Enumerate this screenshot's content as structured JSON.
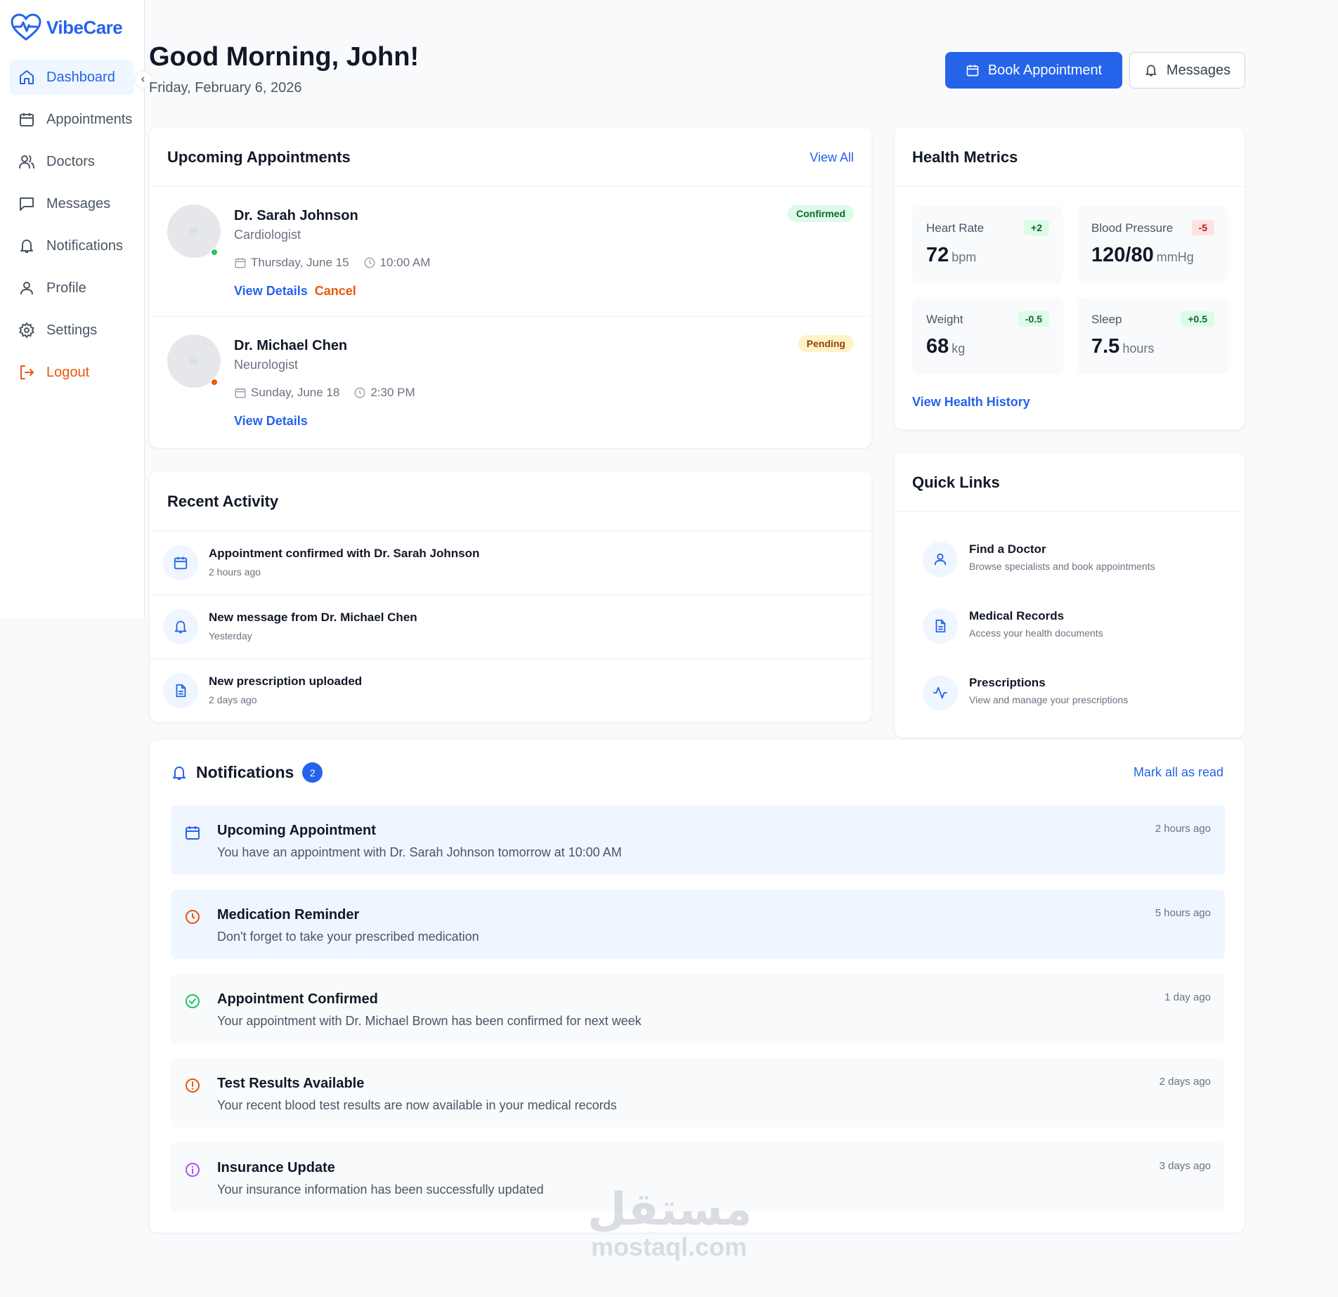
{
  "brand": {
    "name": "VibeCare",
    "color": "#2563eb"
  },
  "sidebar": {
    "items": [
      {
        "label": "Dashboard",
        "icon": "home-icon",
        "active": true
      },
      {
        "label": "Appointments",
        "icon": "calendar-icon"
      },
      {
        "label": "Doctors",
        "icon": "users-icon"
      },
      {
        "label": "Messages",
        "icon": "message-icon"
      },
      {
        "label": "Notifications",
        "icon": "bell-icon"
      },
      {
        "label": "Profile",
        "icon": "user-icon"
      },
      {
        "label": "Settings",
        "icon": "gear-icon"
      },
      {
        "label": "Logout",
        "icon": "logout-icon"
      }
    ]
  },
  "header": {
    "greeting": "Good Morning, John!",
    "date": "Friday, February 6, 2026",
    "book_label": "Book Appointment",
    "messages_label": "Messages"
  },
  "appointments": {
    "title": "Upcoming Appointments",
    "view_all": "View All",
    "items": [
      {
        "doctor": "Dr. Sarah Johnson",
        "specialty": "Cardiologist",
        "date": "Thursday, June 15",
        "time": "10:00 AM",
        "status": "Confirmed",
        "status_color": "#22c55e",
        "view": "View Details",
        "cancel": "Cancel"
      },
      {
        "doctor": "Dr. Michael Chen",
        "specialty": "Neurologist",
        "date": "Sunday, June 18",
        "time": "2:30 PM",
        "status": "Pending",
        "status_color": "#ea580c",
        "view": "View Details"
      }
    ]
  },
  "activity": {
    "title": "Recent Activity",
    "items": [
      {
        "title": "Appointment confirmed with Dr. Sarah Johnson",
        "time": "2 hours ago",
        "icon": "calendar-icon"
      },
      {
        "title": "New message from Dr. Michael Chen",
        "time": "Yesterday",
        "icon": "bell-icon"
      },
      {
        "title": "New prescription uploaded",
        "time": "2 days ago",
        "icon": "document-icon"
      }
    ]
  },
  "health": {
    "title": "Health Metrics",
    "metrics": [
      {
        "label": "Heart Rate",
        "value": "72",
        "unit": "bpm",
        "change": "+2"
      },
      {
        "label": "Blood Pressure",
        "value": "120/80",
        "unit": "mmHg",
        "change": "-5"
      },
      {
        "label": "Weight",
        "value": "68",
        "unit": "kg",
        "change": "-0.5"
      },
      {
        "label": "Sleep",
        "value": "7.5",
        "unit": "hours",
        "change": "+0.5"
      }
    ],
    "history_link": "View Health History"
  },
  "quick_links": {
    "title": "Quick Links",
    "items": [
      {
        "title": "Find a Doctor",
        "desc": "Browse specialists and book appointments",
        "icon": "user-icon"
      },
      {
        "title": "Medical Records",
        "desc": "Access your health documents",
        "icon": "document-icon"
      },
      {
        "title": "Prescriptions",
        "desc": "View and manage your prescriptions",
        "icon": "activity-icon"
      }
    ]
  },
  "notifications": {
    "title": "Notifications",
    "count": "2",
    "mark_all": "Mark all as read",
    "items": [
      {
        "title": "Upcoming Appointment",
        "message": "You have an appointment with Dr. Sarah Johnson tomorrow at 10:00 AM",
        "time": "2 hours ago",
        "icon": "calendar-icon",
        "color": "#2563eb",
        "unread": true
      },
      {
        "title": "Medication Reminder",
        "message": "Don't forget to take your prescribed medication",
        "time": "5 hours ago",
        "icon": "clock-icon",
        "color": "#ea580c",
        "unread": true
      },
      {
        "title": "Appointment Confirmed",
        "message": "Your appointment with Dr. Michael Brown has been confirmed for next week",
        "time": "1 day ago",
        "icon": "check-circle-icon",
        "color": "#22c55e"
      },
      {
        "title": "Test Results Available",
        "message": "Your recent blood test results are now available in your medical records",
        "time": "2 days ago",
        "icon": "alert-circle-icon",
        "color": "#ea580c"
      },
      {
        "title": "Insurance Update",
        "message": "Your insurance information has been successfully updated",
        "time": "3 days ago",
        "icon": "info-icon",
        "color": "#a855f7"
      }
    ]
  },
  "watermark": {
    "arabic": "مستقل",
    "latin": "mostaql.com"
  }
}
